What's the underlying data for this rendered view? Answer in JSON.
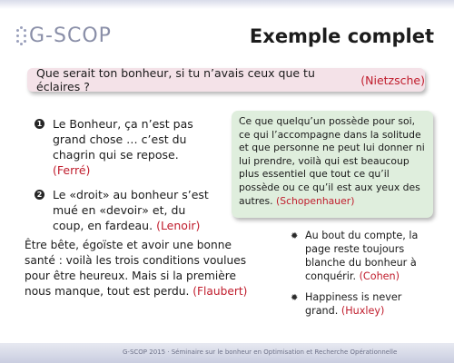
{
  "header": {
    "logo_text": "G-SCOP",
    "title": "Exemple complet"
  },
  "quote_bar": {
    "text": "Que serait ton bonheur, si tu n’avais ceux que tu éclaires ?",
    "author": "(Nietzsche)"
  },
  "enumerated": [
    {
      "number": "1",
      "text": "Le Bonheur, ça n’est pas grand chose … c’est du chagrin qui se repose.",
      "author": "(Ferré)"
    },
    {
      "number": "2",
      "text": "Le «droit» au bonheur s’est mué en «devoir» et, du coup, en fardeau.",
      "author": "(Lenoir)"
    }
  ],
  "box": {
    "text": "Ce que quelqu’un possède pour soi, ce qui l’accompagne dans la solitude et que personne ne peut lui donner ni lui prendre, voilà qui est beaucoup plus essentiel que tout ce qu’il possède ou ce qu’il est aux yeux des autres.",
    "author": "(Schopenhauer)"
  },
  "paragraph": {
    "text": "Être bête, égoïste et avoir une bonne santé : voilà les trois conditions voulues pour être heureux. Mais si la première nous manque, tout est perdu.",
    "author": "(Flaubert)"
  },
  "bullets": [
    {
      "text": "Au bout du compte, la page reste toujours blanche du bonheur à conquérir.",
      "author": "(Cohen)"
    },
    {
      "text": "Happiness is never grand.",
      "author": "(Huxley)"
    }
  ],
  "footer": {
    "text": "G-SCOP 2015 · Séminaire sur le bonheur en Optimisation et Recherche Opérationnelle"
  },
  "colors": {
    "author": "#c01c2c",
    "quote_bg": "#f4e2e8",
    "box_bg": "#dfeedd"
  },
  "icons": {
    "enum_bullet": "numbered-circle-icon",
    "list_bullet": "star-icon"
  }
}
